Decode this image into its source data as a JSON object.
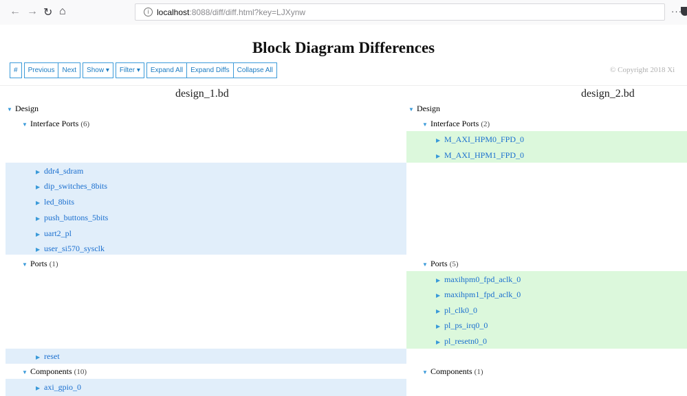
{
  "browser": {
    "url_host": "localhost",
    "url_rest": ":8088/diff/diff.html?key=LJXynw",
    "back_icon": "arrow-left",
    "forward_icon": "arrow-right",
    "reload_icon": "reload",
    "home_icon": "home",
    "menu_label": "···"
  },
  "page": {
    "title": "Block Diagram Differences",
    "copyright": "© Copyright 2018 Xi"
  },
  "toolbar": {
    "hash": "#",
    "previous": "Previous",
    "next": "Next",
    "show": "Show ▾",
    "filter": "Filter ▾",
    "expand_all": "Expand All",
    "expand_diffs": "Expand Diffs",
    "collapse_all": "Collapse All"
  },
  "left": {
    "title": "design_1.bd",
    "design": "Design",
    "interface_ports": {
      "label": "Interface Ports",
      "count": "(6)"
    },
    "interface_items": [
      "ddr4_sdram",
      "dip_switches_8bits",
      "led_8bits",
      "push_buttons_5bits",
      "uart2_pl",
      "user_si570_sysclk"
    ],
    "ports": {
      "label": "Ports",
      "count": "(1)"
    },
    "port_items": [
      "reset"
    ],
    "components": {
      "label": "Components",
      "count": "(10)"
    },
    "component_items": [
      "axi_gpio_0"
    ]
  },
  "right": {
    "title": "design_2.bd",
    "design": "Design",
    "interface_ports": {
      "label": "Interface Ports",
      "count": "(2)"
    },
    "interface_items": [
      "M_AXI_HPM0_FPD_0",
      "M_AXI_HPM1_FPD_0"
    ],
    "ports": {
      "label": "Ports",
      "count": "(5)"
    },
    "port_items": [
      "maxihpm0_fpd_aclk_0",
      "maxihpm1_fpd_aclk_0",
      "pl_clk0_0",
      "pl_ps_irq0_0",
      "pl_resetn0_0"
    ],
    "components": {
      "label": "Components",
      "count": "(1)"
    }
  },
  "colors": {
    "removed_bg": "#e1eefa",
    "added_bg": "#dcf8dc",
    "link": "#1a6fcf",
    "accent": "#3a9ad9"
  }
}
